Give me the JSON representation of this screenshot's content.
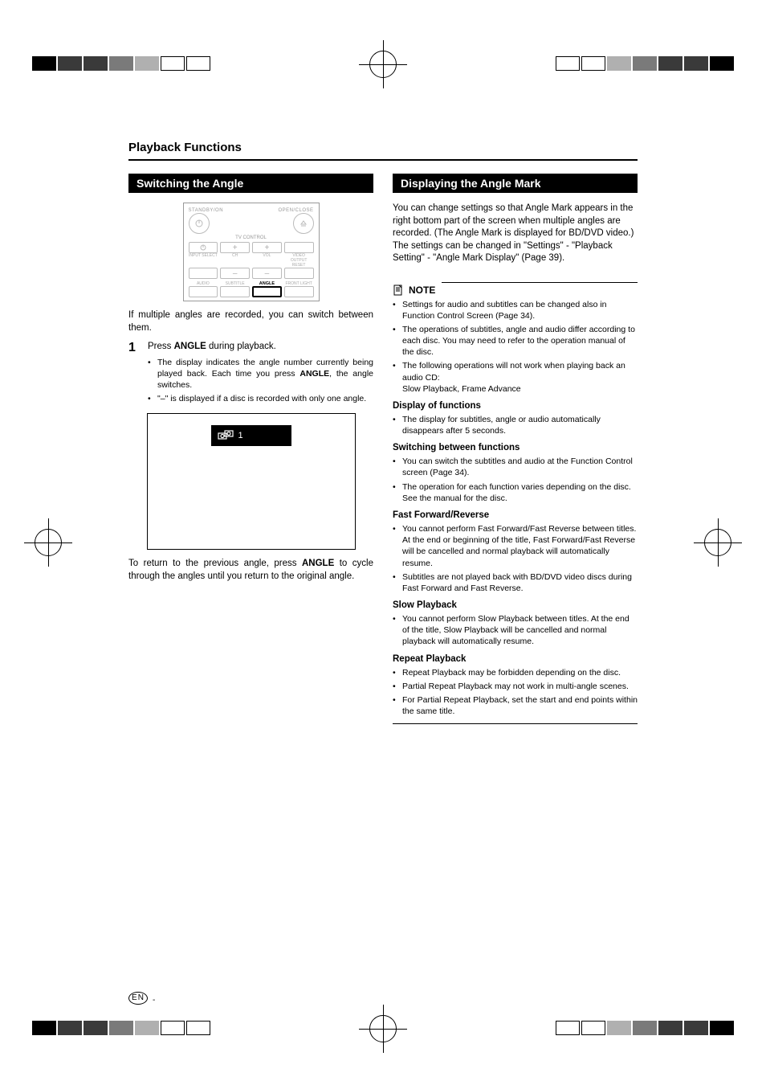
{
  "header_title": "Playback Functions",
  "left": {
    "bar": "Switching the Angle",
    "remote": {
      "standby": "STANDBY/ON",
      "openclose": "OPEN/CLOSE",
      "tv": "TV CONTROL",
      "row2_labels": [
        "INPUT SELECT",
        "CH",
        "VOL",
        "VIDEO OUTPUT RESET"
      ],
      "row3_labels": [
        "AUDIO",
        "SUBTITLE",
        "ANGLE",
        "FRONT LIGHT"
      ]
    },
    "intro": "If multiple angles are recorded, you can switch between them.",
    "step1_num": "1",
    "step1_lead_a": "Press ",
    "step1_lead_b": "ANGLE",
    "step1_lead_c": " during playback.",
    "step1_b1_a": "The display indicates the angle number currently being played back. Each time you press ",
    "step1_b1_b": "ANGLE",
    "step1_b1_c": ", the angle switches.",
    "step1_b2": "\"–\" is displayed if a disc is recorded with only one angle.",
    "display_num": "1",
    "outro_a": "To return to the previous angle, press ",
    "outro_b": "ANGLE",
    "outro_c": " to cycle through the angles until you return to the original angle."
  },
  "right": {
    "bar": "Displaying the Angle Mark",
    "para": "You can change settings so that Angle Mark appears in the right bottom part of the screen when multiple angles are recorded. (The Angle Mark is displayed for BD/DVD video.) The settings can be changed in \"Settings\" - \"Playback Setting\" - \"Angle Mark Display\" (Page 39).",
    "note_label": "NOTE",
    "note_bullets": [
      "Settings for audio and subtitles can be changed also in Function Control Screen (Page 34).",
      "The operations of subtitles, angle and audio differ according to each disc. You may need to refer to the operation manual of the disc.",
      "The following operations will not work when playing back an audio CD:\nSlow Playback, Frame Advance"
    ],
    "h_display": "Display of functions",
    "display_bullets": [
      "The display for subtitles, angle or audio automatically disappears after 5 seconds."
    ],
    "h_switch": "Switching between functions",
    "switch_bullets": [
      "You can switch the subtitles and audio at the Function Control screen (Page 34).",
      "The operation for each function varies depending on the disc. See the manual for the disc."
    ],
    "h_ff": "Fast Forward/Reverse",
    "ff_bullets": [
      "You cannot perform Fast Forward/Fast Reverse between titles. At the end or beginning of the title, Fast Forward/Fast Reverse will be cancelled and normal playback will automatically resume.",
      "Subtitles are not played back with BD/DVD video discs during Fast Forward and Fast Reverse."
    ],
    "h_slow": "Slow Playback",
    "slow_bullets": [
      "You cannot perform Slow Playback between titles. At the end of the title, Slow Playback will be cancelled and normal playback will automatically resume."
    ],
    "h_repeat": "Repeat Playback",
    "repeat_bullets": [
      "Repeat Playback may be forbidden depending on the disc.",
      "Partial Repeat Playback may not work in multi-angle scenes.",
      "For Partial Repeat Playback, set the start and end points within the same title."
    ]
  },
  "footer_en": "EN",
  "footer_dash": "-"
}
